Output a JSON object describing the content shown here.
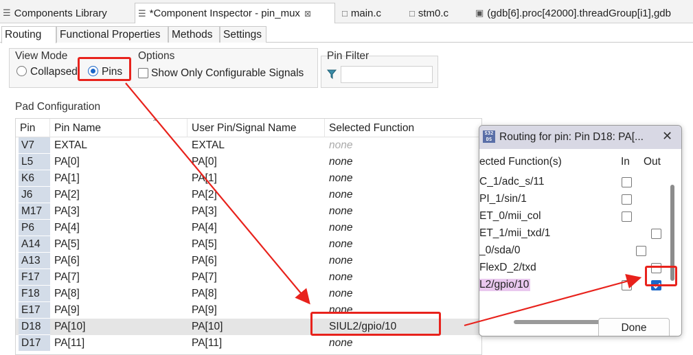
{
  "editor_tabs": [
    {
      "label": "Components Library",
      "icon": "components-icon"
    },
    {
      "label": "*Component Inspector - pin_mux",
      "icon": "plug-icon",
      "close": "⊠"
    },
    {
      "label": "main.c",
      "icon": "c-file-icon"
    },
    {
      "label": "stm0.c",
      "icon": "c-file-icon"
    },
    {
      "label": "(gdb[6].proc[42000].threadGroup[i1],gdb",
      "icon": "debug-icon"
    }
  ],
  "sub_tabs": [
    "Routing",
    "Functional Properties",
    "Methods",
    "Settings"
  ],
  "view_mode": {
    "title": "View Mode",
    "options": [
      "Collapsed",
      "Pins"
    ],
    "selected": "Pins"
  },
  "options_group": {
    "title": "Options",
    "checkbox_label": "Show Only Configurable Signals",
    "checked": false
  },
  "pin_filter": {
    "title": "Pin Filter",
    "value": "",
    "icon": "filter-icon"
  },
  "pad_config": {
    "title": "Pad Configuration",
    "columns": [
      "Pin",
      "Pin Name",
      "User Pin/Signal Name",
      "Selected Function"
    ],
    "rows": [
      {
        "pin": "V7",
        "name": "EXTAL",
        "user": "EXTAL",
        "func": "none",
        "dim": true
      },
      {
        "pin": "L5",
        "name": "PA[0]",
        "user": "PA[0]",
        "func": "none"
      },
      {
        "pin": "K6",
        "name": "PA[1]",
        "user": "PA[1]",
        "func": "none"
      },
      {
        "pin": "J6",
        "name": "PA[2]",
        "user": "PA[2]",
        "func": "none"
      },
      {
        "pin": "M17",
        "name": "PA[3]",
        "user": "PA[3]",
        "func": "none"
      },
      {
        "pin": "P6",
        "name": "PA[4]",
        "user": "PA[4]",
        "func": "none"
      },
      {
        "pin": "A14",
        "name": "PA[5]",
        "user": "PA[5]",
        "func": "none"
      },
      {
        "pin": "A13",
        "name": "PA[6]",
        "user": "PA[6]",
        "func": "none"
      },
      {
        "pin": "F17",
        "name": "PA[7]",
        "user": "PA[7]",
        "func": "none"
      },
      {
        "pin": "F18",
        "name": "PA[8]",
        "user": "PA[8]",
        "func": "none"
      },
      {
        "pin": "E17",
        "name": "PA[9]",
        "user": "PA[9]",
        "func": "none"
      },
      {
        "pin": "D18",
        "name": "PA[10]",
        "user": "PA[10]",
        "func": "SIUL2/gpio/10",
        "selected": true
      },
      {
        "pin": "D17",
        "name": "PA[11]",
        "user": "PA[11]",
        "func": "none"
      }
    ]
  },
  "dialog": {
    "title": "Routing for pin: Pin D18: PA[...",
    "logo": "S32DS",
    "columns": [
      "ected Function(s)",
      "In",
      "Out"
    ],
    "rows": [
      {
        "label": "C_1/adc_s/11",
        "in": false,
        "out": null
      },
      {
        "label": "PI_1/sin/1",
        "in": false,
        "out": null
      },
      {
        "label": "ET_0/mii_col",
        "in": false,
        "out": null
      },
      {
        "label": "ET_1/mii_txd/1",
        "in": null,
        "out": false
      },
      {
        "label": "_0/sda/0",
        "in": null,
        "out": false
      },
      {
        "label": "FlexD_2/txd",
        "in": null,
        "out": false
      },
      {
        "label": "L2/gpio/10",
        "in": false,
        "out": true,
        "highlight": true
      }
    ],
    "done_label": "Done"
  },
  "annotation_color": "#e8221c"
}
